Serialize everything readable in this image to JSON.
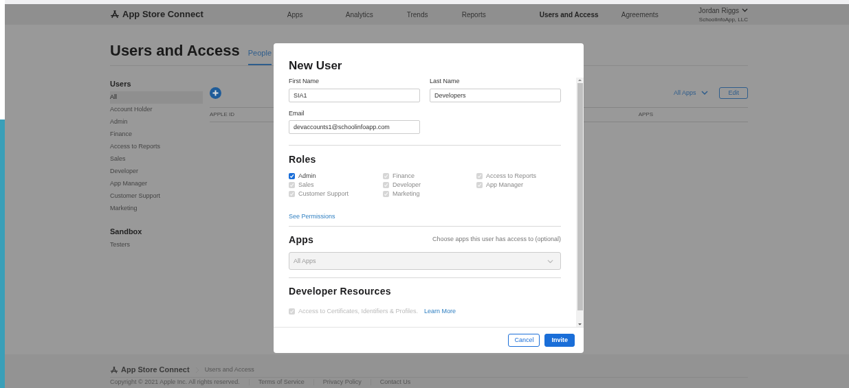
{
  "header": {
    "logo": "App Store Connect",
    "nav": [
      {
        "label": "Apps",
        "selected": false
      },
      {
        "label": "Analytics",
        "selected": false
      },
      {
        "label": "Trends",
        "selected": false
      },
      {
        "label": "Reports",
        "selected": false
      },
      {
        "label": "Users and Access",
        "selected": true
      },
      {
        "label": "Agreements",
        "selected": false
      }
    ],
    "user": "Jordan Riggs",
    "org": "SchoolInfoApp, LLC"
  },
  "page": {
    "title": "Users and Access",
    "tabs": [
      {
        "label": "People",
        "selected": true
      }
    ],
    "sidebar": [
      {
        "heading": "Users",
        "items": [
          {
            "label": "All",
            "selected": true
          },
          {
            "label": "Account Holder",
            "selected": false
          },
          {
            "label": "Admin",
            "selected": false
          },
          {
            "label": "Finance",
            "selected": false
          },
          {
            "label": "Access to Reports",
            "selected": false
          },
          {
            "label": "Sales",
            "selected": false
          },
          {
            "label": "Developer",
            "selected": false
          },
          {
            "label": "App Manager",
            "selected": false
          },
          {
            "label": "Customer Support",
            "selected": false
          },
          {
            "label": "Marketing",
            "selected": false
          }
        ]
      },
      {
        "heading": "Sandbox",
        "items": [
          {
            "label": "Testers",
            "selected": false
          }
        ]
      }
    ],
    "filter": "All Apps",
    "edit_button": "Edit",
    "columns": [
      "APPLE ID",
      "APPS"
    ]
  },
  "modal": {
    "title": "New User",
    "fields": [
      {
        "label": "First Name",
        "value": "SIA1"
      },
      {
        "label": "Last Name",
        "value": "Developers"
      },
      {
        "label": "Email",
        "value": "devaccounts1@schoolinfoapp.com"
      }
    ],
    "roles": {
      "heading": "Roles",
      "items": [
        {
          "label": "Admin",
          "checked": true,
          "disabled": false
        },
        {
          "label": "Finance",
          "checked": true,
          "disabled": true
        },
        {
          "label": "Access to Reports",
          "checked": true,
          "disabled": true
        },
        {
          "label": "Sales",
          "checked": true,
          "disabled": true
        },
        {
          "label": "Developer",
          "checked": true,
          "disabled": true
        },
        {
          "label": "App Manager",
          "checked": true,
          "disabled": true
        },
        {
          "label": "Customer Support",
          "checked": true,
          "disabled": true
        },
        {
          "label": "Marketing",
          "checked": true,
          "disabled": true
        }
      ],
      "link": "See Permissions"
    },
    "apps": {
      "heading": "Apps",
      "hint": "Choose apps this user has access to (optional)",
      "select": {
        "placeholder": "All Apps"
      }
    },
    "developer_resources": {
      "heading": "Developer Resources",
      "item": {
        "label": "Access to Certificates, Identifiers & Profiles.",
        "checked": true,
        "disabled": true
      },
      "link": "Learn More"
    },
    "buttons": [
      {
        "label": "Cancel",
        "kind": "secondary"
      },
      {
        "label": "Invite",
        "kind": "primary"
      }
    ]
  },
  "footer": {
    "logo": "App Store Connect",
    "breadcrumb": "Users and Access",
    "copyright": "Copyright © 2021 Apple Inc. All rights reserved.",
    "links": [
      "Terms of Service",
      "Privacy Policy",
      "Contact Us"
    ]
  }
}
